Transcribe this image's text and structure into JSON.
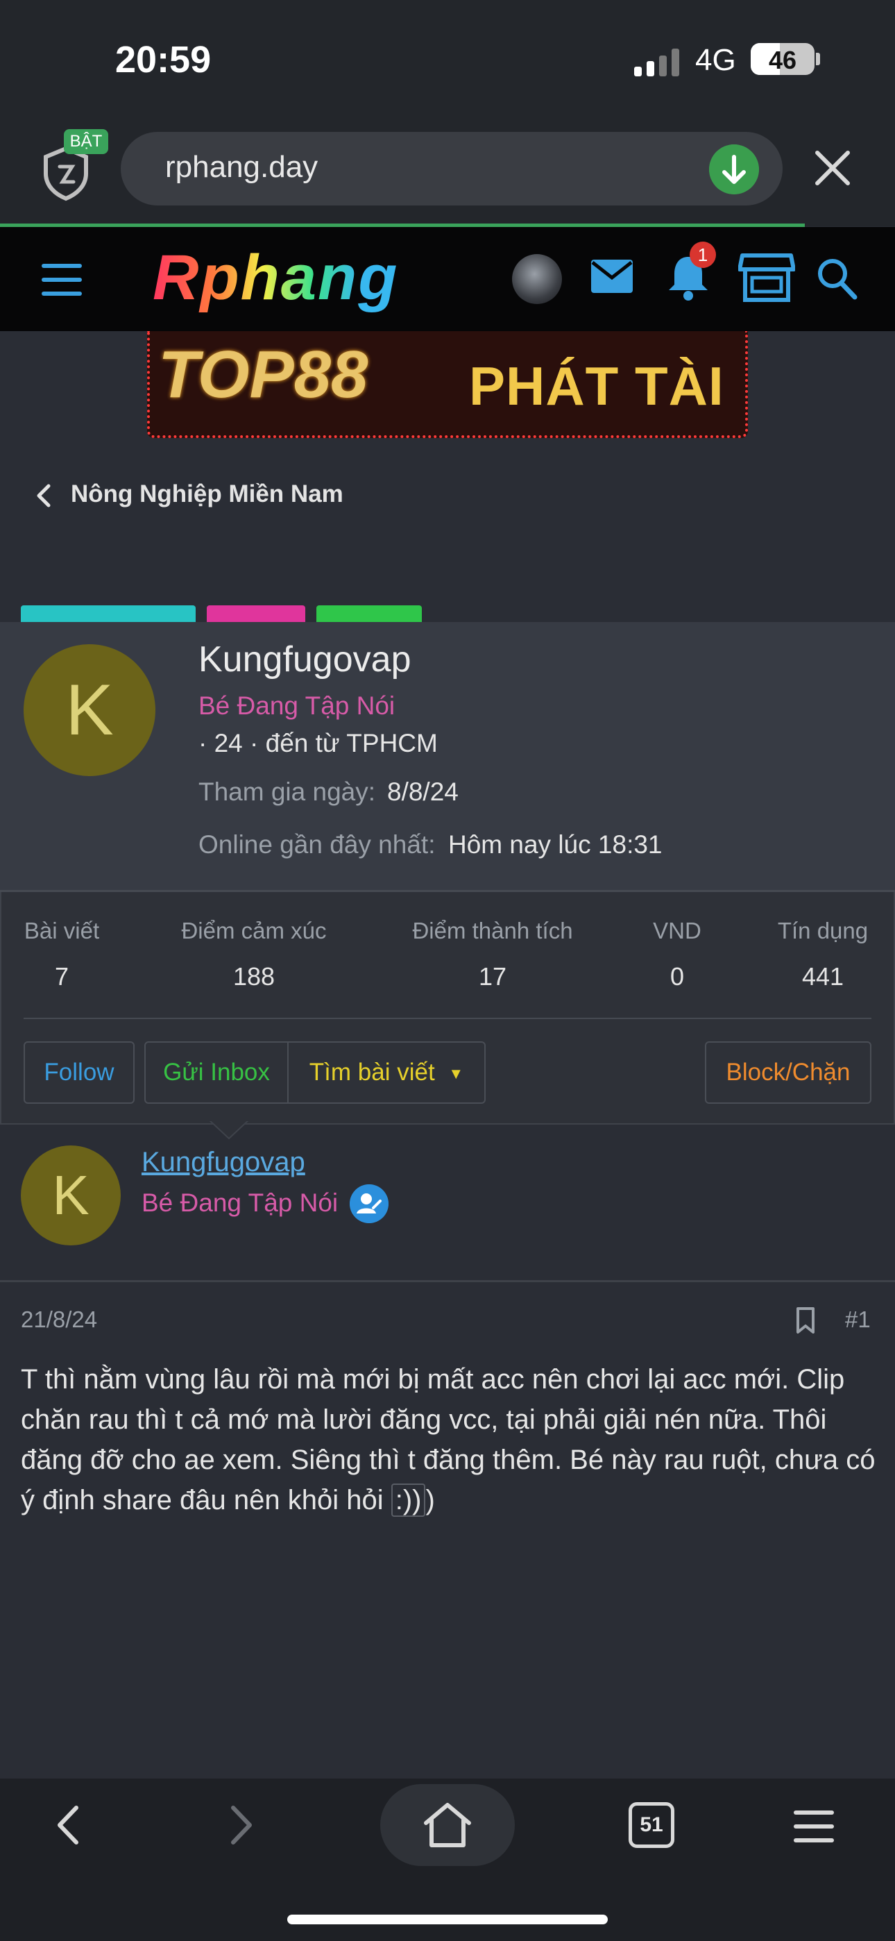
{
  "status_bar": {
    "time": "20:59",
    "network": "4G",
    "battery": "46",
    "battery_level": 0.46
  },
  "browser": {
    "shield_badge": "BẬT",
    "url": "rphang.day"
  },
  "site_header": {
    "logo": "Rphang",
    "notification_count": "1"
  },
  "banner": {
    "brand": "TOP88",
    "slogan": "PHÁT TÀI"
  },
  "breadcrumb": {
    "label": "Nông Nghiệp Miền Nam"
  },
  "member_card": {
    "avatar_letter": "K",
    "name": "Kungfugovap",
    "rank": "Bé Đang Tập Nói",
    "meta": "· 24 · đến từ TPHCM",
    "joined_label": "Tham gia ngày:",
    "joined_value": "8/8/24",
    "online_label": "Online gần đây nhất:",
    "online_value": "Hôm nay lúc 18:31",
    "stats": [
      {
        "label": "Bài viết",
        "value": "7"
      },
      {
        "label": "Điểm cảm xúc",
        "value": "188"
      },
      {
        "label": "Điểm thành tích",
        "value": "17"
      },
      {
        "label": "VND",
        "value": "0"
      },
      {
        "label": "Tín dụng",
        "value": "441"
      }
    ],
    "buttons": {
      "follow": "Follow",
      "inbox": "Gửi Inbox",
      "find_posts": "Tìm bài viết",
      "block": "Block/Chặn"
    }
  },
  "post": {
    "avatar_letter": "K",
    "author": "Kungfugovap",
    "rank": "Bé Đang Tập Nói",
    "date": "21/8/24",
    "number": "#1",
    "body_main": "T thì nằm vùng lâu rồi mà mới bị mất acc nên chơi lại acc mới. Clip chăn rau thì t cả mớ mà lười đăng vcc, tại phải giải nén nữa. Thôi đăng đỡ cho ae xem. Siêng thì t đăng thêm. Bé này rau ruột, chưa có ý định share đâu nên khỏi hỏi ",
    "body_smiley": ":))",
    "body_tail": ")"
  },
  "toolbar": {
    "tab_count": "51"
  },
  "colors": {
    "accent_blue": "#3aa0e0",
    "rank_pink": "#d75ba8",
    "follow_blue": "#3a9de0",
    "inbox_green": "#37c244",
    "find_yellow": "#e6d02b",
    "block_orange": "#f08c2e",
    "badge_red": "#d9352f"
  }
}
